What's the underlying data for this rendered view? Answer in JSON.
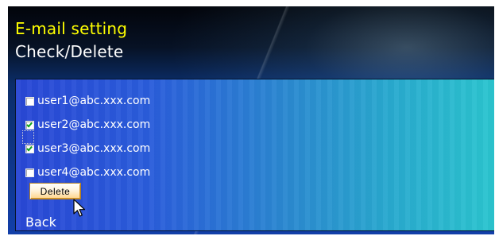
{
  "screen": {
    "title": "E-mail setting",
    "subtitle": "Check/Delete"
  },
  "emails": [
    {
      "address": "user1@abc.xxx.com",
      "checked": false
    },
    {
      "address": "user2@abc.xxx.com",
      "checked": true
    },
    {
      "address": "user3@abc.xxx.com",
      "checked": true
    },
    {
      "address": "user4@abc.xxx.com",
      "checked": false
    }
  ],
  "actions": {
    "delete_label": "Delete",
    "back_label": "Back"
  },
  "icons": {
    "cursor": "mouse-pointer-icon",
    "checkbox_checked": "checkmark-icon"
  },
  "colors": {
    "title": "#ffff00",
    "text": "#ffffff",
    "check": "#10a31b",
    "button_border": "#b07d20"
  }
}
